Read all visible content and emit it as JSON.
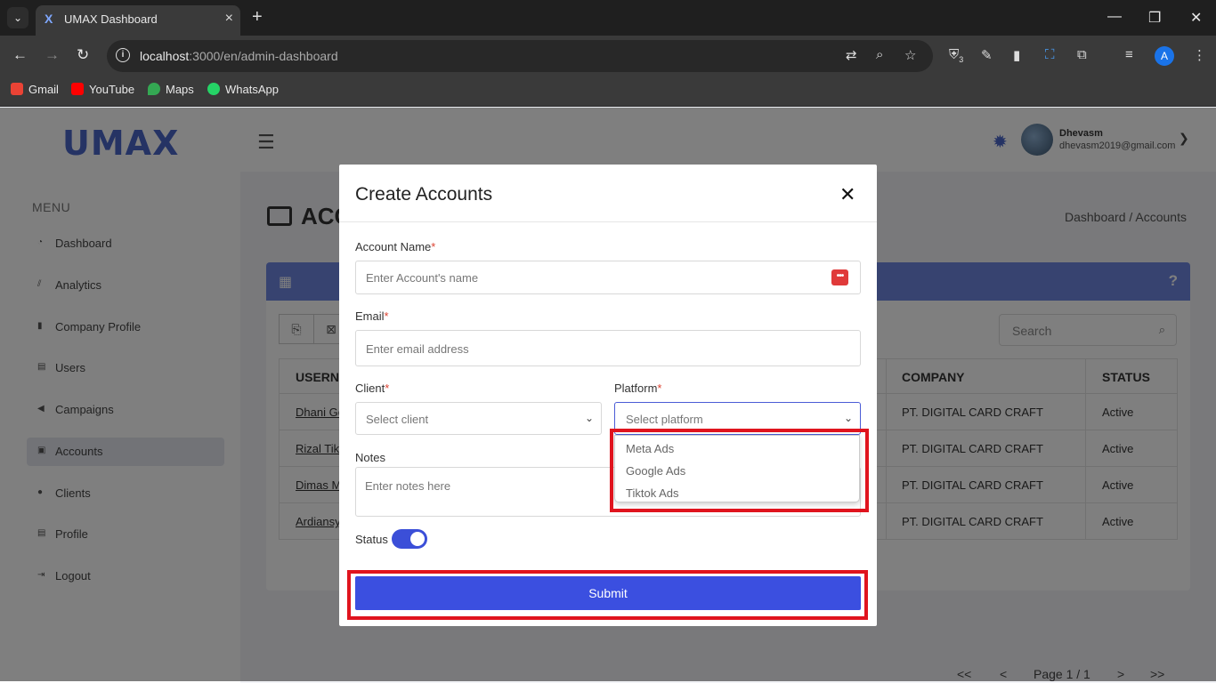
{
  "browser": {
    "tab_title": "UMAX Dashboard",
    "url_host": "localhost",
    "url_rest": ":3000/en/admin-dashboard",
    "ext_badge": "3",
    "profile_initial": "A",
    "bookmarks": [
      "Gmail",
      "YouTube",
      "Maps",
      "WhatsApp"
    ]
  },
  "app": {
    "logo": "UMAX",
    "user_name": "Dhevasm",
    "user_email": "dhevasm2019@gmail.com",
    "menu_label": "MENU",
    "sidebar": [
      {
        "label": "Dashboard",
        "icon": "dashboard-icon"
      },
      {
        "label": "Analytics",
        "icon": "chart-icon"
      },
      {
        "label": "Company Profile",
        "icon": "building-icon"
      },
      {
        "label": "Users",
        "icon": "users-icon"
      },
      {
        "label": "Campaigns",
        "icon": "megaphone-icon"
      },
      {
        "label": "Accounts",
        "icon": "id-card-icon"
      },
      {
        "label": "Clients",
        "icon": "clients-icon"
      },
      {
        "label": "Profile",
        "icon": "profile-icon"
      },
      {
        "label": "Logout",
        "icon": "logout-icon"
      }
    ],
    "page_title": "ACC",
    "breadcrumb": "Dashboard / Accounts",
    "search_placeholder": "Search",
    "table": {
      "headers": [
        "USERNA",
        "COMPANY",
        "STATUS"
      ],
      "rows": [
        {
          "user": "Dhani Go",
          "company": "PT. DIGITAL CARD CRAFT",
          "status": "Active"
        },
        {
          "user": "Rizal Tik",
          "company": "PT. DIGITAL CARD CRAFT",
          "status": "Active"
        },
        {
          "user": "Dimas M",
          "company": "PT. DIGITAL CARD CRAFT",
          "status": "Active"
        },
        {
          "user": "Ardiansy",
          "company": "PT. DIGITAL CARD CRAFT",
          "status": "Active"
        }
      ]
    },
    "pager": {
      "first": "<<",
      "prev": "<",
      "page": "Page 1 / 1",
      "next": ">",
      "last": ">>"
    }
  },
  "modal": {
    "title": "Create Accounts",
    "close": "✕",
    "account_name_label": "Account Name",
    "account_name_placeholder": "Enter Account's name",
    "email_label": "Email",
    "email_placeholder": "Enter email address",
    "client_label": "Client",
    "client_placeholder": "Select client",
    "platform_label": "Platform",
    "platform_placeholder": "Select platform",
    "notes_label": "Notes",
    "notes_placeholder": "Enter notes here",
    "status_label": "Status",
    "status_on": true,
    "submit_label": "Submit",
    "required_mark": "*",
    "platform_options": [
      "Meta Ads",
      "Google Ads",
      "Tiktok Ads"
    ]
  },
  "colors": {
    "accent": "#3b4fe0",
    "card_header": "#6f86e0",
    "highlight": "#e0141e"
  }
}
